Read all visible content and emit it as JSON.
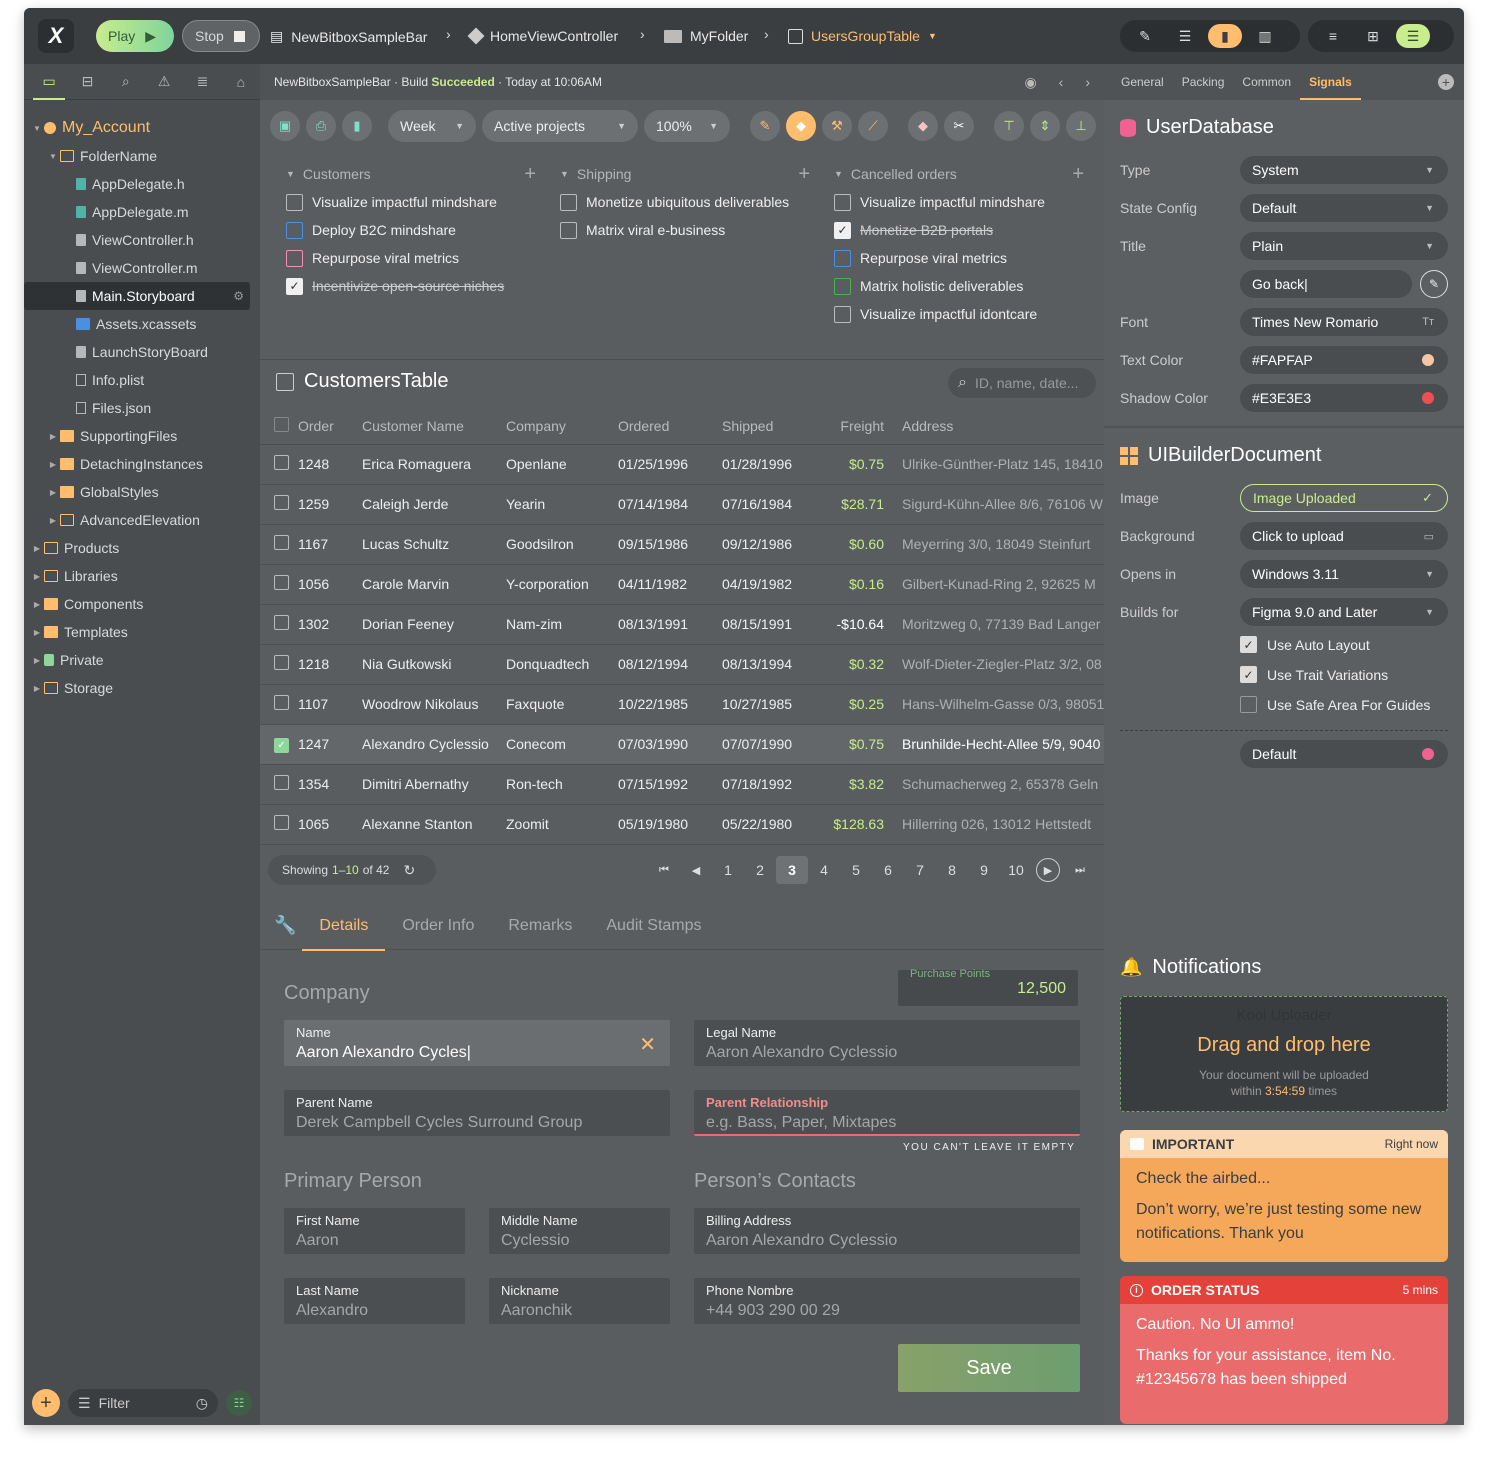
{
  "topbar": {
    "logo": "X",
    "play_label": "Play",
    "stop_label": "Stop",
    "breadcrumbs": [
      "NewBitboxSampleBar",
      "HomeViewController",
      "MyFolder",
      "UsersGroupTable"
    ]
  },
  "sidebar": {
    "tabs": [
      "folder-icon",
      "hierarchy-icon",
      "search-icon",
      "warning-icon",
      "list-icon",
      "tag-icon"
    ],
    "tree": [
      {
        "label": "My_Account",
        "depth": 0,
        "icon": "user",
        "expanded": true,
        "accent": true
      },
      {
        "label": "FolderName",
        "depth": 1,
        "icon": "folder",
        "expanded": true
      },
      {
        "label": "AppDelegate.h",
        "depth": 2,
        "icon": "file-g"
      },
      {
        "label": "AppDelegate.m",
        "depth": 2,
        "icon": "file-g"
      },
      {
        "label": "ViewController.h",
        "depth": 2,
        "icon": "file-w"
      },
      {
        "label": "ViewController.m",
        "depth": 2,
        "icon": "file-w"
      },
      {
        "label": "Main.Storyboard",
        "depth": 2,
        "icon": "file-w",
        "selected": true
      },
      {
        "label": "Assets.xcassets",
        "depth": 2,
        "icon": "file-b"
      },
      {
        "label": "LaunchStoryBoard",
        "depth": 2,
        "icon": "file-w"
      },
      {
        "label": "Info.plist",
        "depth": 2,
        "icon": "file-o"
      },
      {
        "label": "Files.json",
        "depth": 2,
        "icon": "file-o"
      },
      {
        "label": "SupportingFiles",
        "depth": 1,
        "icon": "folder-f",
        "collapsed": true
      },
      {
        "label": "DetachingInstances",
        "depth": 1,
        "icon": "folder-f",
        "collapsed": true
      },
      {
        "label": "GlobalStyles",
        "depth": 1,
        "icon": "folder-f",
        "collapsed": true
      },
      {
        "label": "AdvancedElevation",
        "depth": 1,
        "icon": "folder",
        "collapsed": true
      },
      {
        "label": "Products",
        "depth": 0,
        "icon": "folder",
        "collapsed": true
      },
      {
        "label": "Libraries",
        "depth": 0,
        "icon": "folder",
        "collapsed": true
      },
      {
        "label": "Components",
        "depth": 0,
        "icon": "folder-f",
        "collapsed": true
      },
      {
        "label": "Templates",
        "depth": 0,
        "icon": "folder-f",
        "collapsed": true
      },
      {
        "label": "Private",
        "depth": 0,
        "icon": "lock",
        "collapsed": true
      },
      {
        "label": "Storage",
        "depth": 0,
        "icon": "folder",
        "collapsed": true
      }
    ],
    "filter_placeholder": "Filter"
  },
  "status": {
    "project": "NewBitboxSampleBar",
    "build_prefix": "· Build",
    "build_state": "Succeeded",
    "time": "· Today at 10:06AM"
  },
  "toolbar": {
    "range": "Week",
    "scope": "Active projects",
    "zoom": "100%"
  },
  "checklists": [
    {
      "title": "Customers",
      "items": [
        {
          "label": "Visualize impactful mindshare",
          "color": "grey",
          "checked": false
        },
        {
          "label": "Deploy B2C mindshare",
          "color": "blue",
          "checked": false
        },
        {
          "label": "Repurpose viral metrics",
          "color": "pink",
          "checked": false
        },
        {
          "label": "Incentivize open-source niches",
          "color": "grey",
          "checked": true
        }
      ]
    },
    {
      "title": "Shipping",
      "items": [
        {
          "label": "Monetize ubiquitous deliverables",
          "color": "grey",
          "checked": false
        },
        {
          "label": "Matrix viral e-business",
          "color": "grey",
          "checked": false
        }
      ]
    },
    {
      "title": "Cancelled orders",
      "items": [
        {
          "label": "Visualize impactful mindshare",
          "color": "grey",
          "checked": false
        },
        {
          "label": "Monetize B2B portals",
          "color": "grey",
          "checked": true
        },
        {
          "label": "Repurpose viral metrics",
          "color": "blue",
          "checked": false
        },
        {
          "label": "Matrix holistic deliverables",
          "color": "green",
          "checked": false
        },
        {
          "label": "Visualize impactful idontcare",
          "color": "grey",
          "checked": false
        }
      ]
    }
  ],
  "table": {
    "title": "CustomersTable",
    "search_placeholder": "ID, name, date...",
    "columns": [
      "Order",
      "Customer Name",
      "Company",
      "Ordered",
      "Shipped",
      "Freight",
      "Address"
    ],
    "rows": [
      [
        "1248",
        "Erica Romaguera",
        "Openlane",
        "01/25/1996",
        "01/28/1996",
        "$0.75",
        "Ulrike-Günther-Platz 145, 18410"
      ],
      [
        "1259",
        "Caleigh Jerde",
        "Yearin",
        "07/14/1984",
        "07/16/1984",
        "$28.71",
        "Sigurd-Kühn-Allee 8/6, 76106 W"
      ],
      [
        "1167",
        "Lucas Schultz",
        "Goodsilron",
        "09/15/1986",
        "09/12/1986",
        "$0.60",
        "Meyerring 3/0, 18049 Steinfurt"
      ],
      [
        "1056",
        "Carole Marvin",
        "Y-corporation",
        "04/11/1982",
        "04/19/1982",
        "$0.16",
        "Gilbert-Kunad-Ring 2, 92625 M"
      ],
      [
        "1302",
        "Dorian Feeney",
        "Nam-zim",
        "08/13/1991",
        "08/15/1991",
        "-$10.64",
        "Moritzweg 0, 77139 Bad Langer"
      ],
      [
        "1218",
        "Nia Gutkowski",
        "Donquadtech",
        "08/12/1994",
        "08/13/1994",
        "$0.32",
        "Wolf-Dieter-Ziegler-Platz 3/2, 08"
      ],
      [
        "1107",
        "Woodrow Nikolaus",
        "Faxquote",
        "10/22/1985",
        "10/27/1985",
        "$0.25",
        "Hans-Wilhelm-Gasse 0/3, 98051"
      ],
      [
        "1247",
        "Alexandro Cyclessio",
        "Conecom",
        "07/03/1990",
        "07/07/1990",
        "$0.75",
        "Brunhilde-Hecht-Allee 5/9, 9040"
      ],
      [
        "1354",
        "Dimitri Abernathy",
        "Ron-tech",
        "07/15/1992",
        "07/18/1992",
        "$3.82",
        "Schumacherweg 2, 65378 Geln"
      ],
      [
        "1065",
        "Alexanne Stanton",
        "Zoomit",
        "05/19/1980",
        "05/22/1980",
        "$128.63",
        "Hillerring 026, 13012 Hettstedt"
      ]
    ],
    "selected_row": 7,
    "showing_prefix": "Showing",
    "showing_range": "1–10",
    "showing_suffix": "of 42",
    "pages": [
      "1",
      "2",
      "3",
      "4",
      "5",
      "6",
      "7",
      "8",
      "9",
      "10"
    ],
    "current_page": "3"
  },
  "details": {
    "tabs": [
      "Details",
      "Order Info",
      "Remarks",
      "Audit Stamps"
    ],
    "company_title": "Company",
    "points_label": "Purchase Points",
    "points_value": "12,500",
    "name_label": "Name",
    "name_value": "Aaron Alexandro Cycles|",
    "legal_label": "Legal Name",
    "legal_value": "Aaron Alexandro Cyclessio",
    "parent_label": "Parent Name",
    "parent_value": "Derek Campbell Cycles Surround Group",
    "rel_label": "Parent Relationship",
    "rel_placeholder": "e.g. Bass, Paper, Mixtapes",
    "rel_error": "YOU CAN'T LEAVE IT EMPTY",
    "primary_title": "Primary Person",
    "contacts_title": "Person’s Contacts",
    "first_label": "First Name",
    "first_value": "Aaron",
    "middle_label": "Middle Name",
    "middle_value": "Cyclessio",
    "last_label": "Last Name",
    "last_value": "Alexandro",
    "nick_label": "Nickname",
    "nick_value": "Aaronchik",
    "billing_label": "Billing Address",
    "billing_value": "Aaron Alexandro Cyclessio",
    "phone_label": "Phone Nombre",
    "phone_value": "+44 903 290 00 29",
    "save_label": "Save"
  },
  "inspector": {
    "tabs": [
      "General",
      "Packing",
      "Common",
      "Signals"
    ],
    "db_title": "UserDatabase",
    "type_label": "Type",
    "type_value": "System",
    "state_label": "State Config",
    "state_value": "Default",
    "title_label": "Title",
    "title_value": "Plain",
    "title_text": "Go back|",
    "font_label": "Font",
    "font_value": "Times New Romario",
    "font_icon": "Tт",
    "textcolor_label": "Text Color",
    "textcolor_value": "#FAPFAP",
    "textcolor_hex": "#f5c6a5",
    "shadow_label": "Shadow Color",
    "shadow_value": "#E3E3E3",
    "shadow_hex": "#ec5050",
    "doc_title": "UIBuilderDocument",
    "image_label": "Image",
    "image_value": "Image Uploaded",
    "bg_label": "Background",
    "bg_value": "Click to upload",
    "opens_label": "Opens in",
    "opens_value": "Windows 3.11",
    "builds_label": "Builds for",
    "builds_value": "Figma 9.0 and Later",
    "checks": [
      {
        "label": "Use Auto Layout",
        "checked": true
      },
      {
        "label": "Use Trait Variations",
        "checked": true
      },
      {
        "label": "Use Safe Area For Guides",
        "checked": false
      }
    ],
    "default_value": "Default",
    "default_hex": "#f06292"
  },
  "notifications": {
    "title": "Notifications",
    "uploader_title": "Kool Uploader",
    "uploader_cta": "Drag and drop here",
    "uploader_note_a": "Your document will be uploaded",
    "uploader_note_b": "within",
    "uploader_time": "3:54:59",
    "uploader_note_c": "times",
    "important_tag": "IMPORTANT",
    "important_time": "Right now",
    "important_head": "Check the airbed...",
    "important_body": "Don’t worry, we’re just testing some new notifications. Thank you",
    "order_tag": "ORDER STATUS",
    "order_time": "5 mins",
    "order_head": "Caution. No UI ammo!",
    "order_body": "Thanks for your assistance, item No. #12345678 has been shipped"
  }
}
